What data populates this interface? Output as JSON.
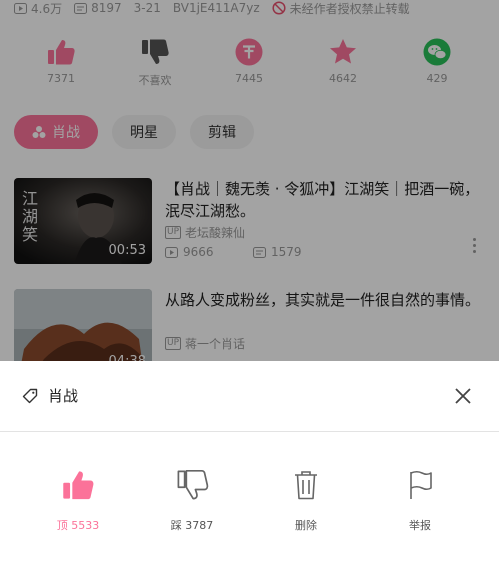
{
  "stats": {
    "play_count": "4.6万",
    "danmaku_count": "8197",
    "date": "3-21",
    "bvid": "BV1jE411A7yz",
    "reprint_notice": "未经作者授权禁止转载"
  },
  "actions": [
    {
      "icon": "thumbs-up-icon",
      "count": "7371"
    },
    {
      "icon": "thumbs-down-icon",
      "count": "不喜欢"
    },
    {
      "icon": "coin-icon",
      "count": "7445"
    },
    {
      "icon": "star-icon",
      "count": "4642"
    },
    {
      "icon": "wechat-icon",
      "count": "429"
    }
  ],
  "tags": [
    "肖战",
    "明星",
    "剪辑"
  ],
  "videos": [
    {
      "title": "【肖战｜魏无羡 · 令狐冲】江湖笑｜把酒一碗，泯尽江湖愁。",
      "duration": "00:53",
      "thumb_text": "江湖笑",
      "uploader": "老坛酸辣仙",
      "up_badge": "UP",
      "plays": "9666",
      "danmaku": "1579"
    },
    {
      "title": "从路人变成粉丝，其实就是一件很自然的事情。",
      "duration": "04:38",
      "uploader": "蒋一个肖话",
      "up_badge": "UP"
    }
  ],
  "sheet": {
    "tag_label": "肖战",
    "actions": [
      {
        "icon": "thumbs-up-icon",
        "label": "顶 5533",
        "color": "#fb7299"
      },
      {
        "icon": "thumbs-down-icon",
        "label": "踩 3787"
      },
      {
        "icon": "trash-icon",
        "label": "删除"
      },
      {
        "icon": "flag-icon",
        "label": "举报"
      }
    ]
  },
  "colors": {
    "accent": "#fb7299",
    "wechat": "#2ac05a",
    "overlay": "rgba(0,0,0,0.36)"
  }
}
